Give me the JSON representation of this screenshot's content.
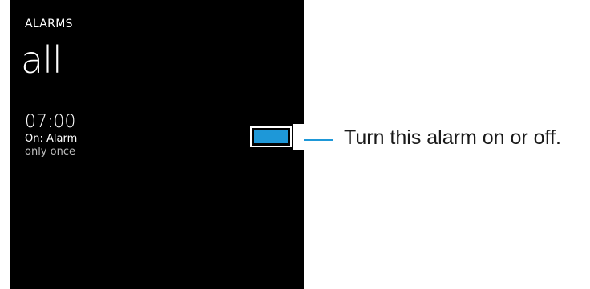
{
  "app": {
    "title": "ALARMS"
  },
  "page": {
    "title": "all"
  },
  "alarm": {
    "time": "07:00",
    "status": "On:  Alarm",
    "repeat": "only once",
    "enabled": true
  },
  "callout": {
    "text": "Turn this alarm on or off."
  },
  "colors": {
    "accent": "#1e98d8",
    "background": "#000000",
    "text": "#ffffff"
  }
}
